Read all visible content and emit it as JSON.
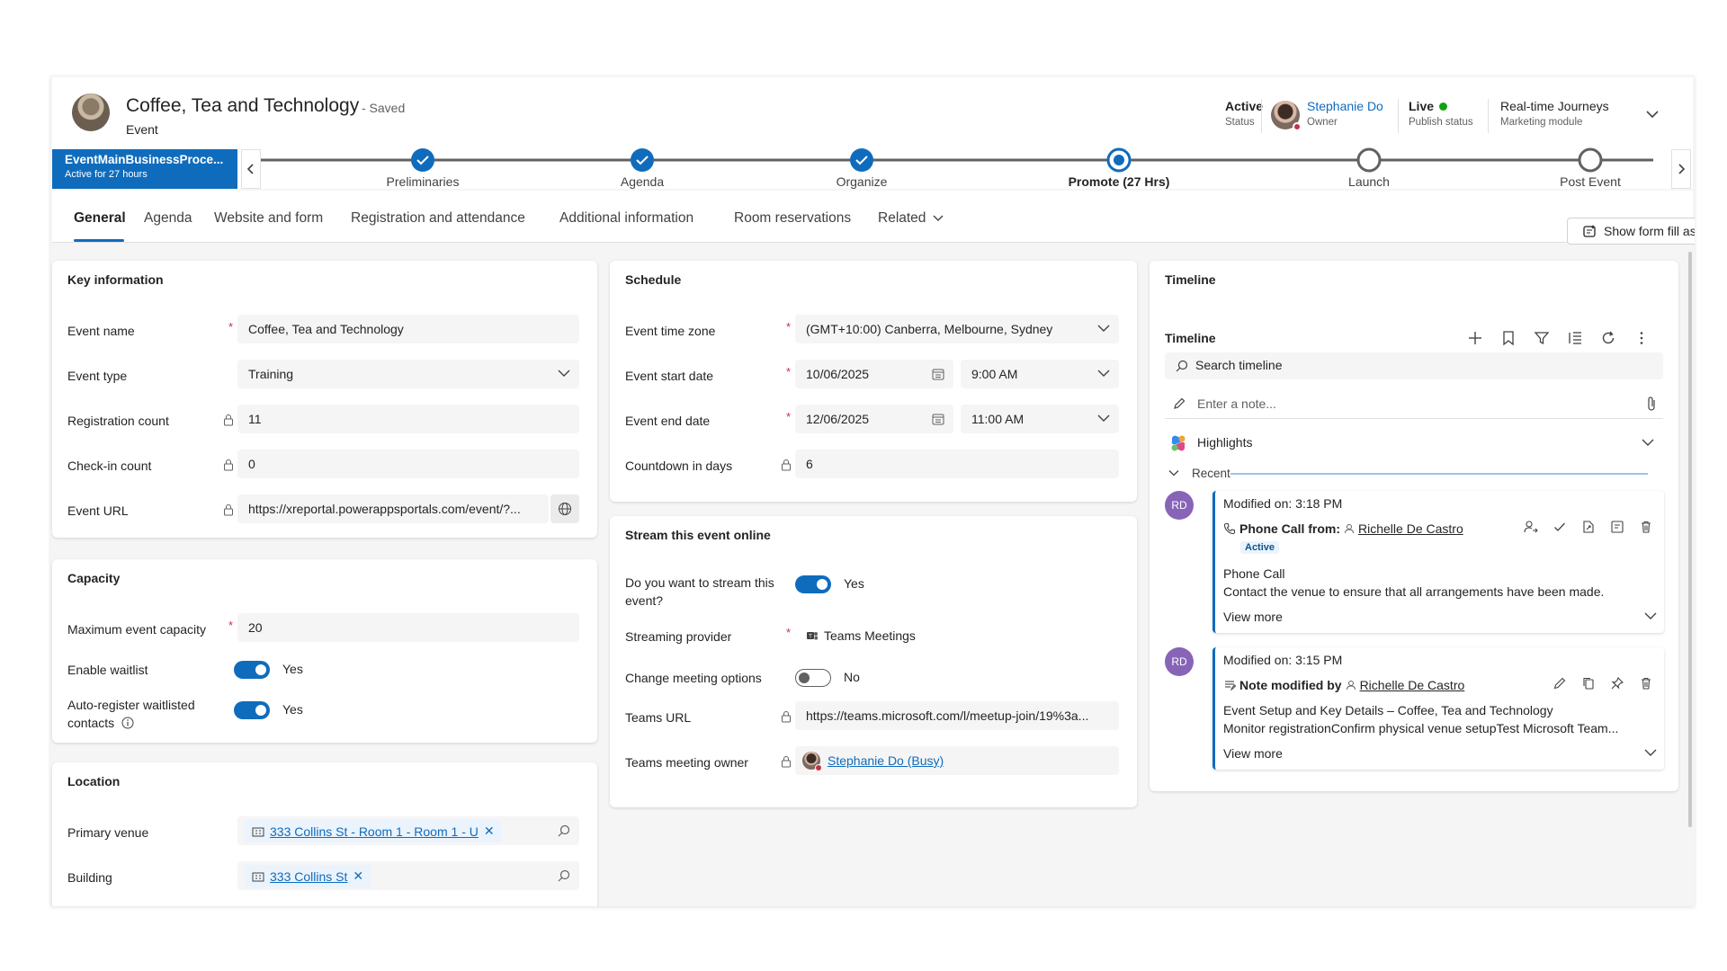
{
  "header": {
    "title": "Coffee, Tea and Technology",
    "saved": "- Saved",
    "entity": "Event",
    "status_value": "Active",
    "status_label": "Status",
    "owner_name": "Stephanie Do",
    "owner_label": "Owner",
    "publish_value": "Live",
    "publish_label": "Publish status",
    "module_value": "Real-time Journeys",
    "module_label": "Marketing module"
  },
  "bpf": {
    "process_name": "EventMainBusinessProce...",
    "process_status": "Active for 27 hours",
    "stages": [
      {
        "label": "Preliminaries",
        "state": "complete"
      },
      {
        "label": "Agenda",
        "state": "complete"
      },
      {
        "label": "Organize",
        "state": "complete"
      },
      {
        "label": "Promote  (27 Hrs)",
        "state": "current"
      },
      {
        "label": "Launch",
        "state": "pending"
      },
      {
        "label": "Post Event",
        "state": "pending"
      }
    ]
  },
  "tabs": {
    "general": "General",
    "agenda": "Agenda",
    "website": "Website and form",
    "registration": "Registration and attendance",
    "additional": "Additional information",
    "rooms": "Room reservations",
    "related": "Related",
    "assist": "Show form fill assist"
  },
  "key_info": {
    "title": "Key information",
    "event_name_label": "Event name",
    "event_name": "Coffee, Tea and Technology",
    "event_type_label": "Event type",
    "event_type": "Training",
    "reg_count_label": "Registration count",
    "reg_count": "11",
    "checkin_label": "Check-in count",
    "checkin": "0",
    "url_label": "Event URL",
    "url": "https://xreportal.powerappsportals.com/event/?..."
  },
  "capacity": {
    "title": "Capacity",
    "max_label": "Maximum event capacity",
    "max": "20",
    "waitlist_label": "Enable waitlist",
    "waitlist": "Yes",
    "auto_label": "Auto-register waitlisted contacts",
    "auto": "Yes"
  },
  "location": {
    "title": "Location",
    "venue_label": "Primary venue",
    "venue": "333 Collins St - Room 1 - Room 1 - U",
    "building_label": "Building",
    "building": "333 Collins St"
  },
  "schedule": {
    "title": "Schedule",
    "tz_label": "Event time zone",
    "tz": "(GMT+10:00) Canberra, Melbourne, Sydney",
    "start_label": "Event start date",
    "start_date": "10/06/2025",
    "start_time": "9:00 AM",
    "end_label": "Event end date",
    "end_date": "12/06/2025",
    "end_time": "11:00 AM",
    "countdown_label": "Countdown in days",
    "countdown": "6"
  },
  "stream": {
    "title": "Stream this event online",
    "stream_label": "Do you want to stream this event?",
    "stream": "Yes",
    "provider_label": "Streaming provider",
    "provider": "Teams Meetings",
    "change_label": "Change meeting options",
    "change": "No",
    "teams_url_label": "Teams URL",
    "teams_url": "https://teams.microsoft.com/l/meetup-join/19%3a...",
    "owner_label": "Teams meeting owner",
    "owner": "Stephanie Do (Busy)"
  },
  "timeline": {
    "title": "Timeline",
    "subtitle": "Timeline",
    "search_placeholder": "Search timeline",
    "note_placeholder": "Enter a note...",
    "highlights": "Highlights",
    "recent": "Recent",
    "activities": [
      {
        "initials": "RD",
        "modified": "Modified on: 3:18 PM",
        "type": "Phone Call from:",
        "who": "Richelle De Castro",
        "badge": "Active",
        "line1": "Phone Call",
        "line2": "Contact the venue to ensure that all arrangements have been made.",
        "more": "View more"
      },
      {
        "initials": "RD",
        "modified": "Modified on: 3:15 PM",
        "type": "Note modified by",
        "who": "Richelle De Castro",
        "line1": "Event Setup and Key Details – Coffee, Tea and Technology",
        "line2": "Monitor registrationConfirm physical venue setupTest Microsoft Team...",
        "more": "View more"
      }
    ]
  },
  "colors": {
    "accent": "#0f6cbd",
    "required": "#c4314b",
    "live": "#13a10e"
  }
}
